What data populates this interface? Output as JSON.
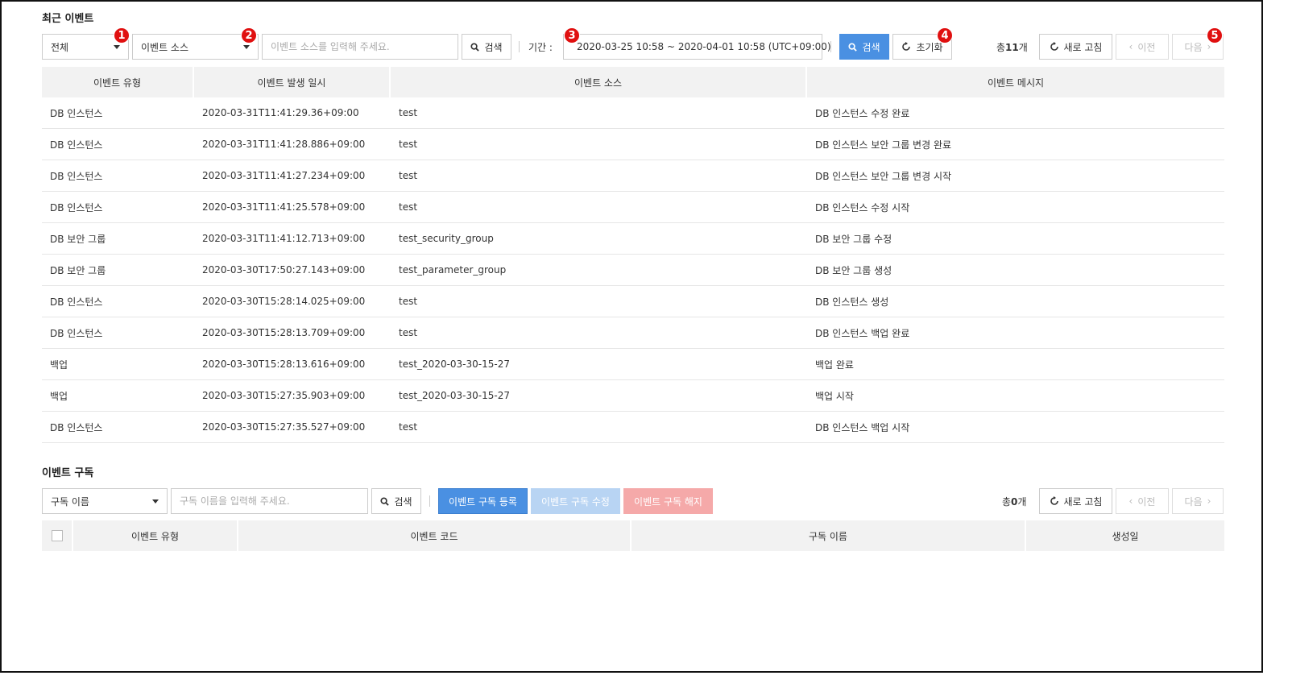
{
  "recent_events": {
    "title": "최근 이벤트",
    "filter_select": "전체",
    "source_select": "이벤트 소스",
    "search_placeholder": "이벤트 소스를 입력해 주세요.",
    "search_button": "검색",
    "period_label": "기간 :",
    "period_value": "2020-03-25 10:58 ~ 2020-04-01 10:58 (UTC+09:00)",
    "search_primary_button": "검색",
    "reset_button": "초기화",
    "total_prefix": "총",
    "total_count": "11",
    "total_suffix": "개",
    "refresh_button": "새로 고침",
    "prev_button": "이전",
    "next_button": "다음",
    "badges": [
      "1",
      "2",
      "3",
      "4",
      "5"
    ],
    "columns": [
      "이벤트 유형",
      "이벤트 발생 일시",
      "이벤트 소스",
      "이벤트 메시지"
    ],
    "rows": [
      [
        "DB 인스턴스",
        "2020-03-31T11:41:29.36+09:00",
        "test",
        "DB 인스턴스 수정 완료"
      ],
      [
        "DB 인스턴스",
        "2020-03-31T11:41:28.886+09:00",
        "test",
        "DB 인스턴스 보안 그룹 변경 완료"
      ],
      [
        "DB 인스턴스",
        "2020-03-31T11:41:27.234+09:00",
        "test",
        "DB 인스턴스 보안 그룹 변경 시작"
      ],
      [
        "DB 인스턴스",
        "2020-03-31T11:41:25.578+09:00",
        "test",
        "DB 인스턴스 수정 시작"
      ],
      [
        "DB 보안 그룹",
        "2020-03-31T11:41:12.713+09:00",
        "test_security_group",
        "DB 보안 그룹 수정"
      ],
      [
        "DB 보안 그룹",
        "2020-03-30T17:50:27.143+09:00",
        "test_parameter_group",
        "DB 보안 그룹 생성"
      ],
      [
        "DB 인스턴스",
        "2020-03-30T15:28:14.025+09:00",
        "test",
        "DB 인스턴스 생성"
      ],
      [
        "DB 인스턴스",
        "2020-03-30T15:28:13.709+09:00",
        "test",
        "DB 인스턴스 백업 완료"
      ],
      [
        "백업",
        "2020-03-30T15:28:13.616+09:00",
        "test_2020-03-30-15-27",
        "백업 완료"
      ],
      [
        "백업",
        "2020-03-30T15:27:35.903+09:00",
        "test_2020-03-30-15-27",
        "백업 시작"
      ],
      [
        "DB 인스턴스",
        "2020-03-30T15:27:35.527+09:00",
        "test",
        "DB 인스턴스 백업 시작"
      ]
    ]
  },
  "subscriptions": {
    "title": "이벤트 구독",
    "name_select": "구독 이름",
    "search_placeholder": "구독 이름을 입력해 주세요.",
    "search_button": "검색",
    "register_button": "이벤트 구독 등록",
    "edit_button": "이벤트 구독 수정",
    "cancel_button": "이벤트 구독 해지",
    "total_prefix": "총",
    "total_count": "0",
    "total_suffix": "개",
    "refresh_button": "새로 고침",
    "prev_button": "이전",
    "next_button": "다음",
    "columns": [
      "이벤트 유형",
      "이벤트 코드",
      "구독 이름",
      "생성일"
    ]
  },
  "colors": {
    "primary": "#4a90e2",
    "badge": "#e01010",
    "header_bg": "#f2f2f2"
  }
}
